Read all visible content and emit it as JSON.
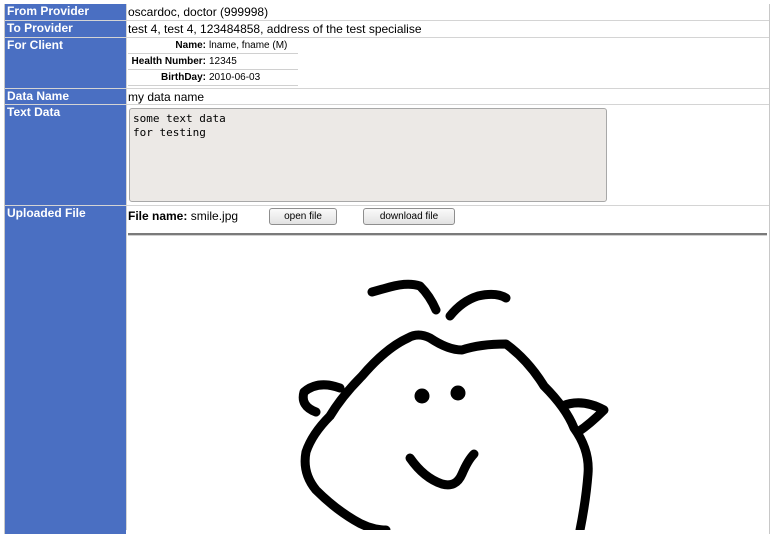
{
  "rows": {
    "from_provider": {
      "label": "From Provider",
      "value": "oscardoc, doctor (999998)"
    },
    "to_provider": {
      "label": "To Provider",
      "value": "test 4, test 4, 123484858, address of the test specialise"
    },
    "for_client": {
      "label": "For Client"
    },
    "data_name": {
      "label": "Data Name",
      "value": "my data name"
    },
    "text_data": {
      "label": "Text Data",
      "value": "some text data\nfor testing"
    },
    "uploaded_file": {
      "label": "Uploaded File"
    }
  },
  "client": {
    "name_label": "Name:",
    "name_value": "lname, fname (M)",
    "hn_label": "Health Number:",
    "hn_value": "12345",
    "bd_label": "BirthDay:",
    "bd_value": "2010-06-03"
  },
  "file": {
    "name_label": "File name:",
    "name_value": "smile.jpg",
    "open_label": "open file",
    "download_label": "download file"
  }
}
